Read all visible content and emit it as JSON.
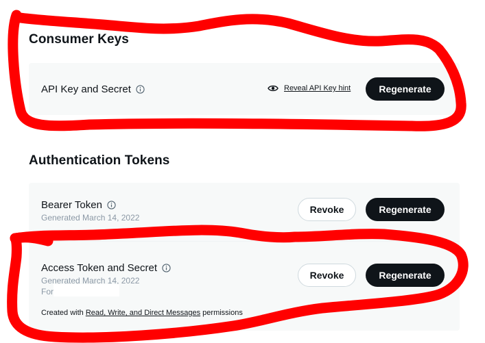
{
  "consumer": {
    "title": "Consumer Keys",
    "row": {
      "label": "API Key and Secret",
      "reveal_label": "Reveal API Key hint",
      "regenerate_label": "Regenerate"
    }
  },
  "auth": {
    "title": "Authentication Tokens",
    "bearer": {
      "label": "Bearer Token",
      "generated": "Generated March 14, 2022",
      "revoke_label": "Revoke",
      "regenerate_label": "Regenerate"
    },
    "access": {
      "label": "Access Token and Secret",
      "generated": "Generated March 14, 2022",
      "for_label": "For",
      "revoke_label": "Revoke",
      "regenerate_label": "Regenerate",
      "created_prefix": "Created with ",
      "permissions": "Read, Write, and Direct Messages",
      "created_suffix": " permissions"
    }
  },
  "colors": {
    "annotation": "#ff0000",
    "panel_bg": "#f7f9f9",
    "button_dark": "#0f1419",
    "muted_text": "#8b98a5"
  },
  "icons": {
    "info": "info-circle-icon",
    "reveal": "eye-icon"
  }
}
